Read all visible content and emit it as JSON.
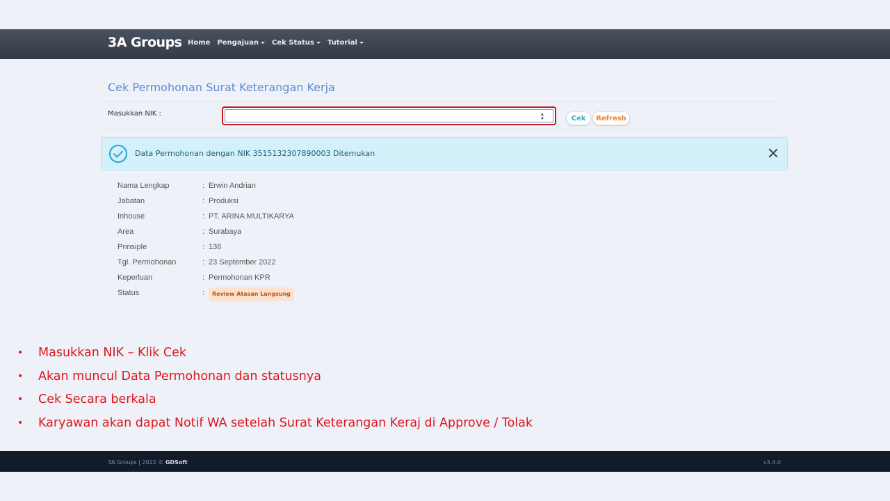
{
  "navbar": {
    "brand": "3A Groups",
    "items": [
      {
        "label": "Home",
        "dropdown": false
      },
      {
        "label": "Pengajuan",
        "dropdown": true
      },
      {
        "label": "Cek Status",
        "dropdown": true
      },
      {
        "label": "Tutorial",
        "dropdown": true
      }
    ]
  },
  "form": {
    "title": "Cek Permohonan Surat Keterangan Kerja",
    "nik_label": "Masukkan NIK :",
    "nik_value": "",
    "cek_label": "Cek",
    "refresh_label": "Refresh"
  },
  "alert": {
    "message": "Data Permohonan dengan NIK 3515132307890003 Ditemukan",
    "color": "#d4f1fb"
  },
  "details": [
    {
      "label": "Nama Lengkap",
      "value": "Erwin Andrian"
    },
    {
      "label": "Jabatan",
      "value": "Produksi"
    },
    {
      "label": "Inhouse",
      "value": "PT. ARINA MULTIKARYA"
    },
    {
      "label": "Area",
      "value": "Surabaya"
    },
    {
      "label": "Prinsiple",
      "value": "136"
    },
    {
      "label": "Tgl. Permohonan",
      "value": "23 September 2022"
    },
    {
      "label": "Keperluan",
      "value": "Permohonan KPR"
    }
  ],
  "status": {
    "label": "Status",
    "value": "Review Atasan Langsung"
  },
  "separator": ":",
  "bullet_glyph": "•",
  "instructions": [
    "Masukkan NIK – Klik Cek",
    "Akan muncul Data Permohonan dan statusnya",
    "Cek Secara berkala",
    "Karyawan akan dapat Notif WA setelah Surat Keterangan Keraj di Approve / Tolak"
  ],
  "footer": {
    "left": "3A Groups | 2022 © ",
    "left_brand": "GDSoft",
    "version": "v3.4.0"
  }
}
